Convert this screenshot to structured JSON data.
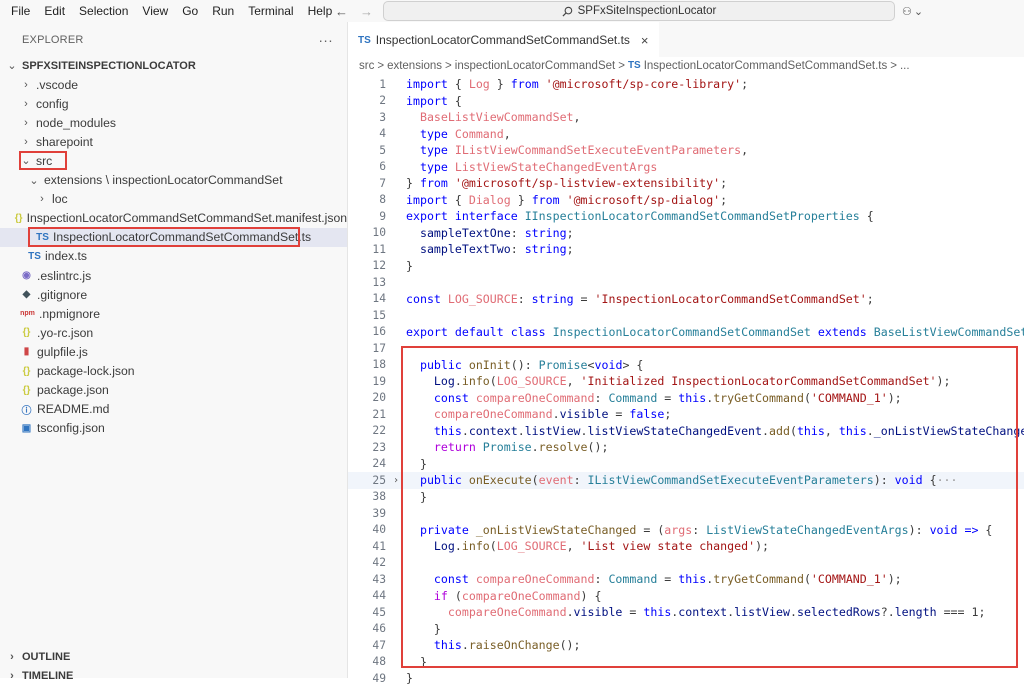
{
  "menu": [
    "File",
    "Edit",
    "Selection",
    "View",
    "Go",
    "Run",
    "Terminal",
    "Help"
  ],
  "search": {
    "text": "SPFxSiteInspectionLocator"
  },
  "explorer": {
    "title": "EXPLORER",
    "more": "···",
    "project": "SPFXSITEINSPECTIONLOCATOR",
    "items": [
      {
        "label": ".vscode",
        "type": "folder",
        "indent": 1,
        "open": false
      },
      {
        "label": "config",
        "type": "folder",
        "indent": 1,
        "open": false
      },
      {
        "label": "node_modules",
        "type": "folder",
        "indent": 1,
        "open": false
      },
      {
        "label": "sharepoint",
        "type": "folder",
        "indent": 1,
        "open": false
      },
      {
        "label": "src",
        "type": "folder",
        "indent": 1,
        "open": true
      },
      {
        "label": "extensions \\ inspectionLocatorCommandSet",
        "type": "folder",
        "indent": 2,
        "open": true
      },
      {
        "label": "loc",
        "type": "folder",
        "indent": 3,
        "open": false
      },
      {
        "label": "InspectionLocatorCommandSetCommandSet.manifest.json",
        "type": "json",
        "indent": 3
      },
      {
        "label": "InspectionLocatorCommandSetCommandSet.ts",
        "type": "ts",
        "indent": 3,
        "selected": true
      },
      {
        "label": "index.ts",
        "type": "ts",
        "indent": 2
      },
      {
        "label": ".eslintrc.js",
        "type": "eslint",
        "indent": 1
      },
      {
        "label": ".gitignore",
        "type": "git",
        "indent": 1
      },
      {
        "label": ".npmignore",
        "type": "npm",
        "indent": 1
      },
      {
        "label": ".yo-rc.json",
        "type": "json",
        "indent": 1
      },
      {
        "label": "gulpfile.js",
        "type": "gulp",
        "indent": 1
      },
      {
        "label": "package-lock.json",
        "type": "json",
        "indent": 1
      },
      {
        "label": "package.json",
        "type": "json",
        "indent": 1
      },
      {
        "label": "README.md",
        "type": "info",
        "indent": 1
      },
      {
        "label": "tsconfig.json",
        "type": "tsconfig",
        "indent": 1
      }
    ],
    "outline": "OUTLINE",
    "timeline": "TIMELINE"
  },
  "tab": {
    "badge": "TS",
    "label": "InspectionLocatorCommandSetCommandSet.ts",
    "close": "×"
  },
  "breadcrumbs": [
    "src",
    ">",
    "extensions",
    ">",
    "inspectionLocatorCommandSet",
    ">",
    "TS",
    "InspectionLocatorCommandSetCommandSet.ts",
    ">",
    "..."
  ],
  "code": [
    {
      "n": "1",
      "t": [
        [
          "kw",
          "import"
        ],
        [
          "p",
          " { "
        ],
        [
          "var",
          "Log"
        ],
        [
          "p",
          " } "
        ],
        [
          "kw",
          "from"
        ],
        [
          "p",
          " "
        ],
        [
          "str",
          "'@microsoft/sp-core-library'"
        ],
        [
          "p",
          ";"
        ]
      ]
    },
    {
      "n": "2",
      "t": [
        [
          "kw",
          "import"
        ],
        [
          "p",
          " {"
        ]
      ]
    },
    {
      "n": "3",
      "t": [
        [
          "p",
          "  "
        ],
        [
          "var",
          "BaseListViewCommandSet"
        ],
        [
          "p",
          ","
        ]
      ]
    },
    {
      "n": "4",
      "t": [
        [
          "p",
          "  "
        ],
        [
          "kw",
          "type"
        ],
        [
          "p",
          " "
        ],
        [
          "var",
          "Command"
        ],
        [
          "p",
          ","
        ]
      ]
    },
    {
      "n": "5",
      "t": [
        [
          "p",
          "  "
        ],
        [
          "kw",
          "type"
        ],
        [
          "p",
          " "
        ],
        [
          "var",
          "IListViewCommandSetExecuteEventParameters"
        ],
        [
          "p",
          ","
        ]
      ]
    },
    {
      "n": "6",
      "t": [
        [
          "p",
          "  "
        ],
        [
          "kw",
          "type"
        ],
        [
          "p",
          " "
        ],
        [
          "var",
          "ListViewStateChangedEventArgs"
        ]
      ]
    },
    {
      "n": "7",
      "t": [
        [
          "p",
          "} "
        ],
        [
          "kw",
          "from"
        ],
        [
          "p",
          " "
        ],
        [
          "str",
          "'@microsoft/sp-listview-extensibility'"
        ],
        [
          "p",
          ";"
        ]
      ]
    },
    {
      "n": "8",
      "t": [
        [
          "kw",
          "import"
        ],
        [
          "p",
          " { "
        ],
        [
          "var",
          "Dialog"
        ],
        [
          "p",
          " } "
        ],
        [
          "kw",
          "from"
        ],
        [
          "p",
          " "
        ],
        [
          "str",
          "'@microsoft/sp-dialog'"
        ],
        [
          "p",
          ";"
        ]
      ]
    },
    {
      "n": "9",
      "t": [
        [
          "kw",
          "export"
        ],
        [
          "p",
          " "
        ],
        [
          "kw",
          "interface"
        ],
        [
          "p",
          " "
        ],
        [
          "type",
          "IInspectionLocatorCommandSetCommandSetProperties"
        ],
        [
          "p",
          " {"
        ]
      ]
    },
    {
      "n": "10",
      "t": [
        [
          "p",
          "  "
        ],
        [
          "prop",
          "sampleTextOne"
        ],
        [
          "p",
          ": "
        ],
        [
          "kw",
          "string"
        ],
        [
          "p",
          ";"
        ]
      ]
    },
    {
      "n": "11",
      "t": [
        [
          "p",
          "  "
        ],
        [
          "prop",
          "sampleTextTwo"
        ],
        [
          "p",
          ": "
        ],
        [
          "kw",
          "string"
        ],
        [
          "p",
          ";"
        ]
      ]
    },
    {
      "n": "12",
      "t": [
        [
          "p",
          "}"
        ]
      ]
    },
    {
      "n": "13",
      "t": []
    },
    {
      "n": "14",
      "t": [
        [
          "kw",
          "const"
        ],
        [
          "p",
          " "
        ],
        [
          "var",
          "LOG_SOURCE"
        ],
        [
          "p",
          ": "
        ],
        [
          "kw",
          "string"
        ],
        [
          "p",
          " = "
        ],
        [
          "str",
          "'InspectionLocatorCommandSetCommandSet'"
        ],
        [
          "p",
          ";"
        ]
      ]
    },
    {
      "n": "15",
      "t": []
    },
    {
      "n": "16",
      "t": [
        [
          "kw",
          "export"
        ],
        [
          "p",
          " "
        ],
        [
          "kw",
          "default"
        ],
        [
          "p",
          " "
        ],
        [
          "kw",
          "class"
        ],
        [
          "p",
          " "
        ],
        [
          "type",
          "InspectionLocatorCommandSetCommandSet"
        ],
        [
          "p",
          " "
        ],
        [
          "kw",
          "extends"
        ],
        [
          "p",
          " "
        ],
        [
          "type",
          "BaseListViewCommandSet<II"
        ]
      ]
    },
    {
      "n": "17",
      "t": []
    },
    {
      "n": "18",
      "t": [
        [
          "p",
          "  "
        ],
        [
          "kw",
          "public"
        ],
        [
          "p",
          " "
        ],
        [
          "fn",
          "onInit"
        ],
        [
          "p",
          "(): "
        ],
        [
          "type",
          "Promise"
        ],
        [
          "p",
          "<"
        ],
        [
          "kw",
          "void"
        ],
        [
          "p",
          "> {"
        ]
      ]
    },
    {
      "n": "19",
      "t": [
        [
          "p",
          "    "
        ],
        [
          "prop",
          "Log"
        ],
        [
          "p",
          "."
        ],
        [
          "fn",
          "info"
        ],
        [
          "p",
          "("
        ],
        [
          "var",
          "LOG_SOURCE"
        ],
        [
          "p",
          ", "
        ],
        [
          "str",
          "'Initialized InspectionLocatorCommandSetCommandSet'"
        ],
        [
          "p",
          ");"
        ]
      ]
    },
    {
      "n": "20",
      "t": [
        [
          "p",
          "    "
        ],
        [
          "kw",
          "const"
        ],
        [
          "p",
          " "
        ],
        [
          "var",
          "compareOneCommand"
        ],
        [
          "p",
          ": "
        ],
        [
          "type",
          "Command"
        ],
        [
          "p",
          " = "
        ],
        [
          "kw",
          "this"
        ],
        [
          "p",
          "."
        ],
        [
          "fn",
          "tryGetCommand"
        ],
        [
          "p",
          "("
        ],
        [
          "str",
          "'COMMAND_1'"
        ],
        [
          "p",
          ");"
        ]
      ]
    },
    {
      "n": "21",
      "t": [
        [
          "p",
          "    "
        ],
        [
          "var",
          "compareOneCommand"
        ],
        [
          "p",
          "."
        ],
        [
          "prop",
          "visible"
        ],
        [
          "p",
          " = "
        ],
        [
          "kw",
          "false"
        ],
        [
          "p",
          ";"
        ]
      ]
    },
    {
      "n": "22",
      "t": [
        [
          "p",
          "    "
        ],
        [
          "kw",
          "this"
        ],
        [
          "p",
          "."
        ],
        [
          "prop",
          "context"
        ],
        [
          "p",
          "."
        ],
        [
          "prop",
          "listView"
        ],
        [
          "p",
          "."
        ],
        [
          "prop",
          "listViewStateChangedEvent"
        ],
        [
          "p",
          "."
        ],
        [
          "fn",
          "add"
        ],
        [
          "p",
          "("
        ],
        [
          "kw",
          "this"
        ],
        [
          "p",
          ", "
        ],
        [
          "kw",
          "this"
        ],
        [
          "p",
          "."
        ],
        [
          "prop",
          "_onListViewStateChanged"
        ],
        [
          "p",
          ");"
        ]
      ]
    },
    {
      "n": "23",
      "t": [
        [
          "p",
          "    "
        ],
        [
          "ctl",
          "return"
        ],
        [
          "p",
          " "
        ],
        [
          "type",
          "Promise"
        ],
        [
          "p",
          "."
        ],
        [
          "fn",
          "resolve"
        ],
        [
          "p",
          "();"
        ]
      ]
    },
    {
      "n": "24",
      "t": [
        [
          "p",
          "  }"
        ]
      ]
    },
    {
      "n": "25",
      "t": [
        [
          "p",
          "  "
        ],
        [
          "kw",
          "public"
        ],
        [
          "p",
          " "
        ],
        [
          "fn",
          "onExecute"
        ],
        [
          "p",
          "("
        ],
        [
          "var",
          "event"
        ],
        [
          "p",
          ": "
        ],
        [
          "type",
          "IListViewCommandSetExecuteEventParameters"
        ],
        [
          "p",
          "): "
        ],
        [
          "kw",
          "void"
        ],
        [
          "p",
          " {"
        ],
        [
          "dim",
          "···"
        ]
      ],
      "hl": true,
      "fold": "›"
    },
    {
      "n": "38",
      "t": [
        [
          "p",
          "  }"
        ]
      ]
    },
    {
      "n": "39",
      "t": []
    },
    {
      "n": "40",
      "t": [
        [
          "p",
          "  "
        ],
        [
          "kw",
          "private"
        ],
        [
          "p",
          " "
        ],
        [
          "fn",
          "_onListViewStateChanged"
        ],
        [
          "p",
          " = ("
        ],
        [
          "var",
          "args"
        ],
        [
          "p",
          ": "
        ],
        [
          "type",
          "ListViewStateChangedEventArgs"
        ],
        [
          "p",
          "): "
        ],
        [
          "kw",
          "void"
        ],
        [
          "p",
          " "
        ],
        [
          "kw",
          "=>"
        ],
        [
          "p",
          " {"
        ]
      ]
    },
    {
      "n": "41",
      "t": [
        [
          "p",
          "    "
        ],
        [
          "prop",
          "Log"
        ],
        [
          "p",
          "."
        ],
        [
          "fn",
          "info"
        ],
        [
          "p",
          "("
        ],
        [
          "var",
          "LOG_SOURCE"
        ],
        [
          "p",
          ", "
        ],
        [
          "str",
          "'List view state changed'"
        ],
        [
          "p",
          ");"
        ]
      ]
    },
    {
      "n": "42",
      "t": []
    },
    {
      "n": "43",
      "t": [
        [
          "p",
          "    "
        ],
        [
          "kw",
          "const"
        ],
        [
          "p",
          " "
        ],
        [
          "var",
          "compareOneCommand"
        ],
        [
          "p",
          ": "
        ],
        [
          "type",
          "Command"
        ],
        [
          "p",
          " = "
        ],
        [
          "kw",
          "this"
        ],
        [
          "p",
          "."
        ],
        [
          "fn",
          "tryGetCommand"
        ],
        [
          "p",
          "("
        ],
        [
          "str",
          "'COMMAND_1'"
        ],
        [
          "p",
          ");"
        ]
      ]
    },
    {
      "n": "44",
      "t": [
        [
          "p",
          "    "
        ],
        [
          "ctl",
          "if"
        ],
        [
          "p",
          " ("
        ],
        [
          "var",
          "compareOneCommand"
        ],
        [
          "p",
          ") {"
        ]
      ]
    },
    {
      "n": "45",
      "t": [
        [
          "p",
          "      "
        ],
        [
          "var",
          "compareOneCommand"
        ],
        [
          "p",
          "."
        ],
        [
          "prop",
          "visible"
        ],
        [
          "p",
          " = "
        ],
        [
          "kw",
          "this"
        ],
        [
          "p",
          "."
        ],
        [
          "prop",
          "context"
        ],
        [
          "p",
          "."
        ],
        [
          "prop",
          "listView"
        ],
        [
          "p",
          "."
        ],
        [
          "prop",
          "selectedRows"
        ],
        [
          "p",
          "?."
        ],
        [
          "prop",
          "length"
        ],
        [
          "p",
          " === "
        ],
        [
          "p",
          "1;"
        ]
      ]
    },
    {
      "n": "46",
      "t": [
        [
          "p",
          "    }"
        ]
      ]
    },
    {
      "n": "47",
      "t": [
        [
          "p",
          "    "
        ],
        [
          "kw",
          "this"
        ],
        [
          "p",
          "."
        ],
        [
          "fn",
          "raiseOnChange"
        ],
        [
          "p",
          "();"
        ]
      ]
    },
    {
      "n": "48",
      "t": [
        [
          "p",
          "  }"
        ]
      ]
    },
    {
      "n": "49",
      "t": [
        [
          "p",
          "}"
        ]
      ]
    }
  ]
}
